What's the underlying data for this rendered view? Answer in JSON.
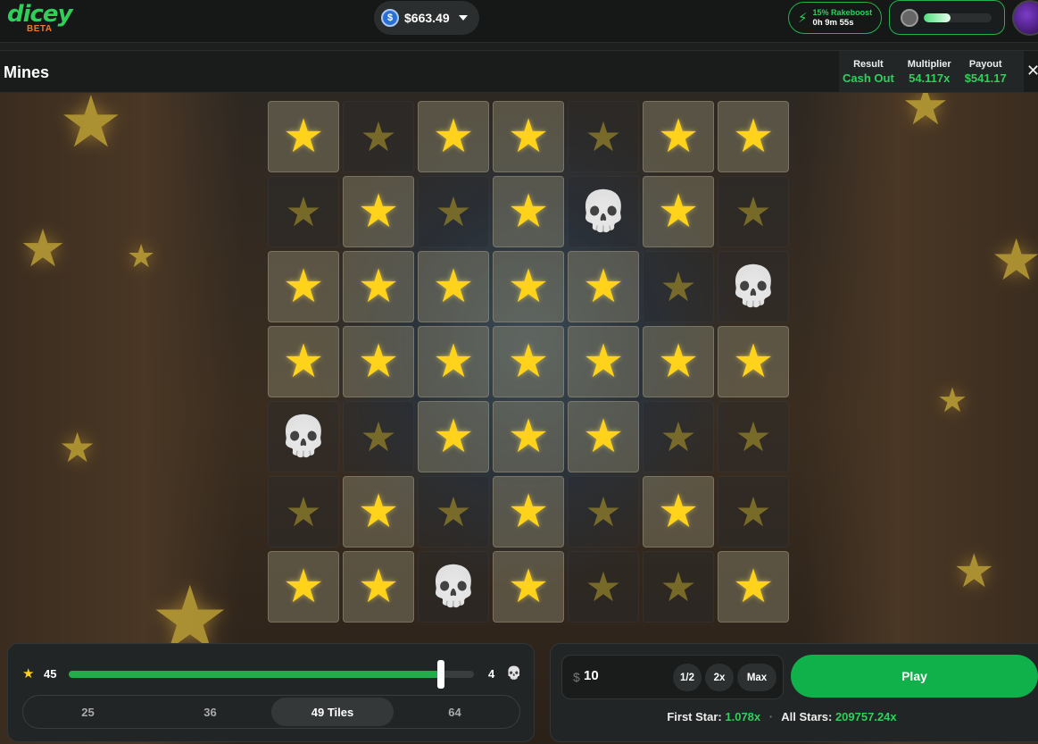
{
  "brand": {
    "name": "dicey",
    "badge": "BETA"
  },
  "wallet": {
    "balance": "$663.49",
    "coin_icon": "dollar-coin-icon"
  },
  "rakeboost": {
    "label": "15% Rakeboost",
    "timer": "0h 9m 55s"
  },
  "xp": {
    "progress": 0.4
  },
  "game": {
    "title": "Mines"
  },
  "result": {
    "result_label": "Result",
    "result_value": "Cash Out",
    "multiplier_label": "Multiplier",
    "multiplier_value": "54.117x",
    "payout_label": "Payout",
    "payout_value": "$541.17"
  },
  "board": {
    "rows": [
      [
        "s",
        "d",
        "s",
        "s",
        "d",
        "s",
        "s"
      ],
      [
        "d",
        "s",
        "d",
        "s",
        "m",
        "s",
        "d"
      ],
      [
        "s",
        "s",
        "s",
        "s",
        "s",
        "d",
        "m"
      ],
      [
        "s",
        "s",
        "s",
        "s",
        "s",
        "s",
        "s"
      ],
      [
        "m",
        "d",
        "s",
        "s",
        "s",
        "d",
        "d"
      ],
      [
        "d",
        "s",
        "d",
        "s",
        "d",
        "s",
        "d"
      ],
      [
        "s",
        "s",
        "m",
        "s",
        "d",
        "d",
        "s"
      ]
    ],
    "legend": {
      "s": "revealed-star",
      "d": "unrevealed-star",
      "m": "mine"
    }
  },
  "controls": {
    "stars_count": "45",
    "mines_count": "4",
    "slider_fraction": 0.918,
    "tile_options": [
      "25",
      "36",
      "49 Tiles",
      "64"
    ],
    "active_tile_index": 2
  },
  "bet": {
    "currency": "$",
    "amount": "10",
    "half_label": "1/2",
    "double_label": "2x",
    "max_label": "Max",
    "play_label": "Play",
    "first_star_label": "First Star:",
    "first_star_value": "1.078x",
    "all_stars_label": "All Stars:",
    "all_stars_value": "209757.24x"
  },
  "colors": {
    "accent": "#2fd05a",
    "play": "#10b04a",
    "brand_beta": "#f27a21"
  }
}
